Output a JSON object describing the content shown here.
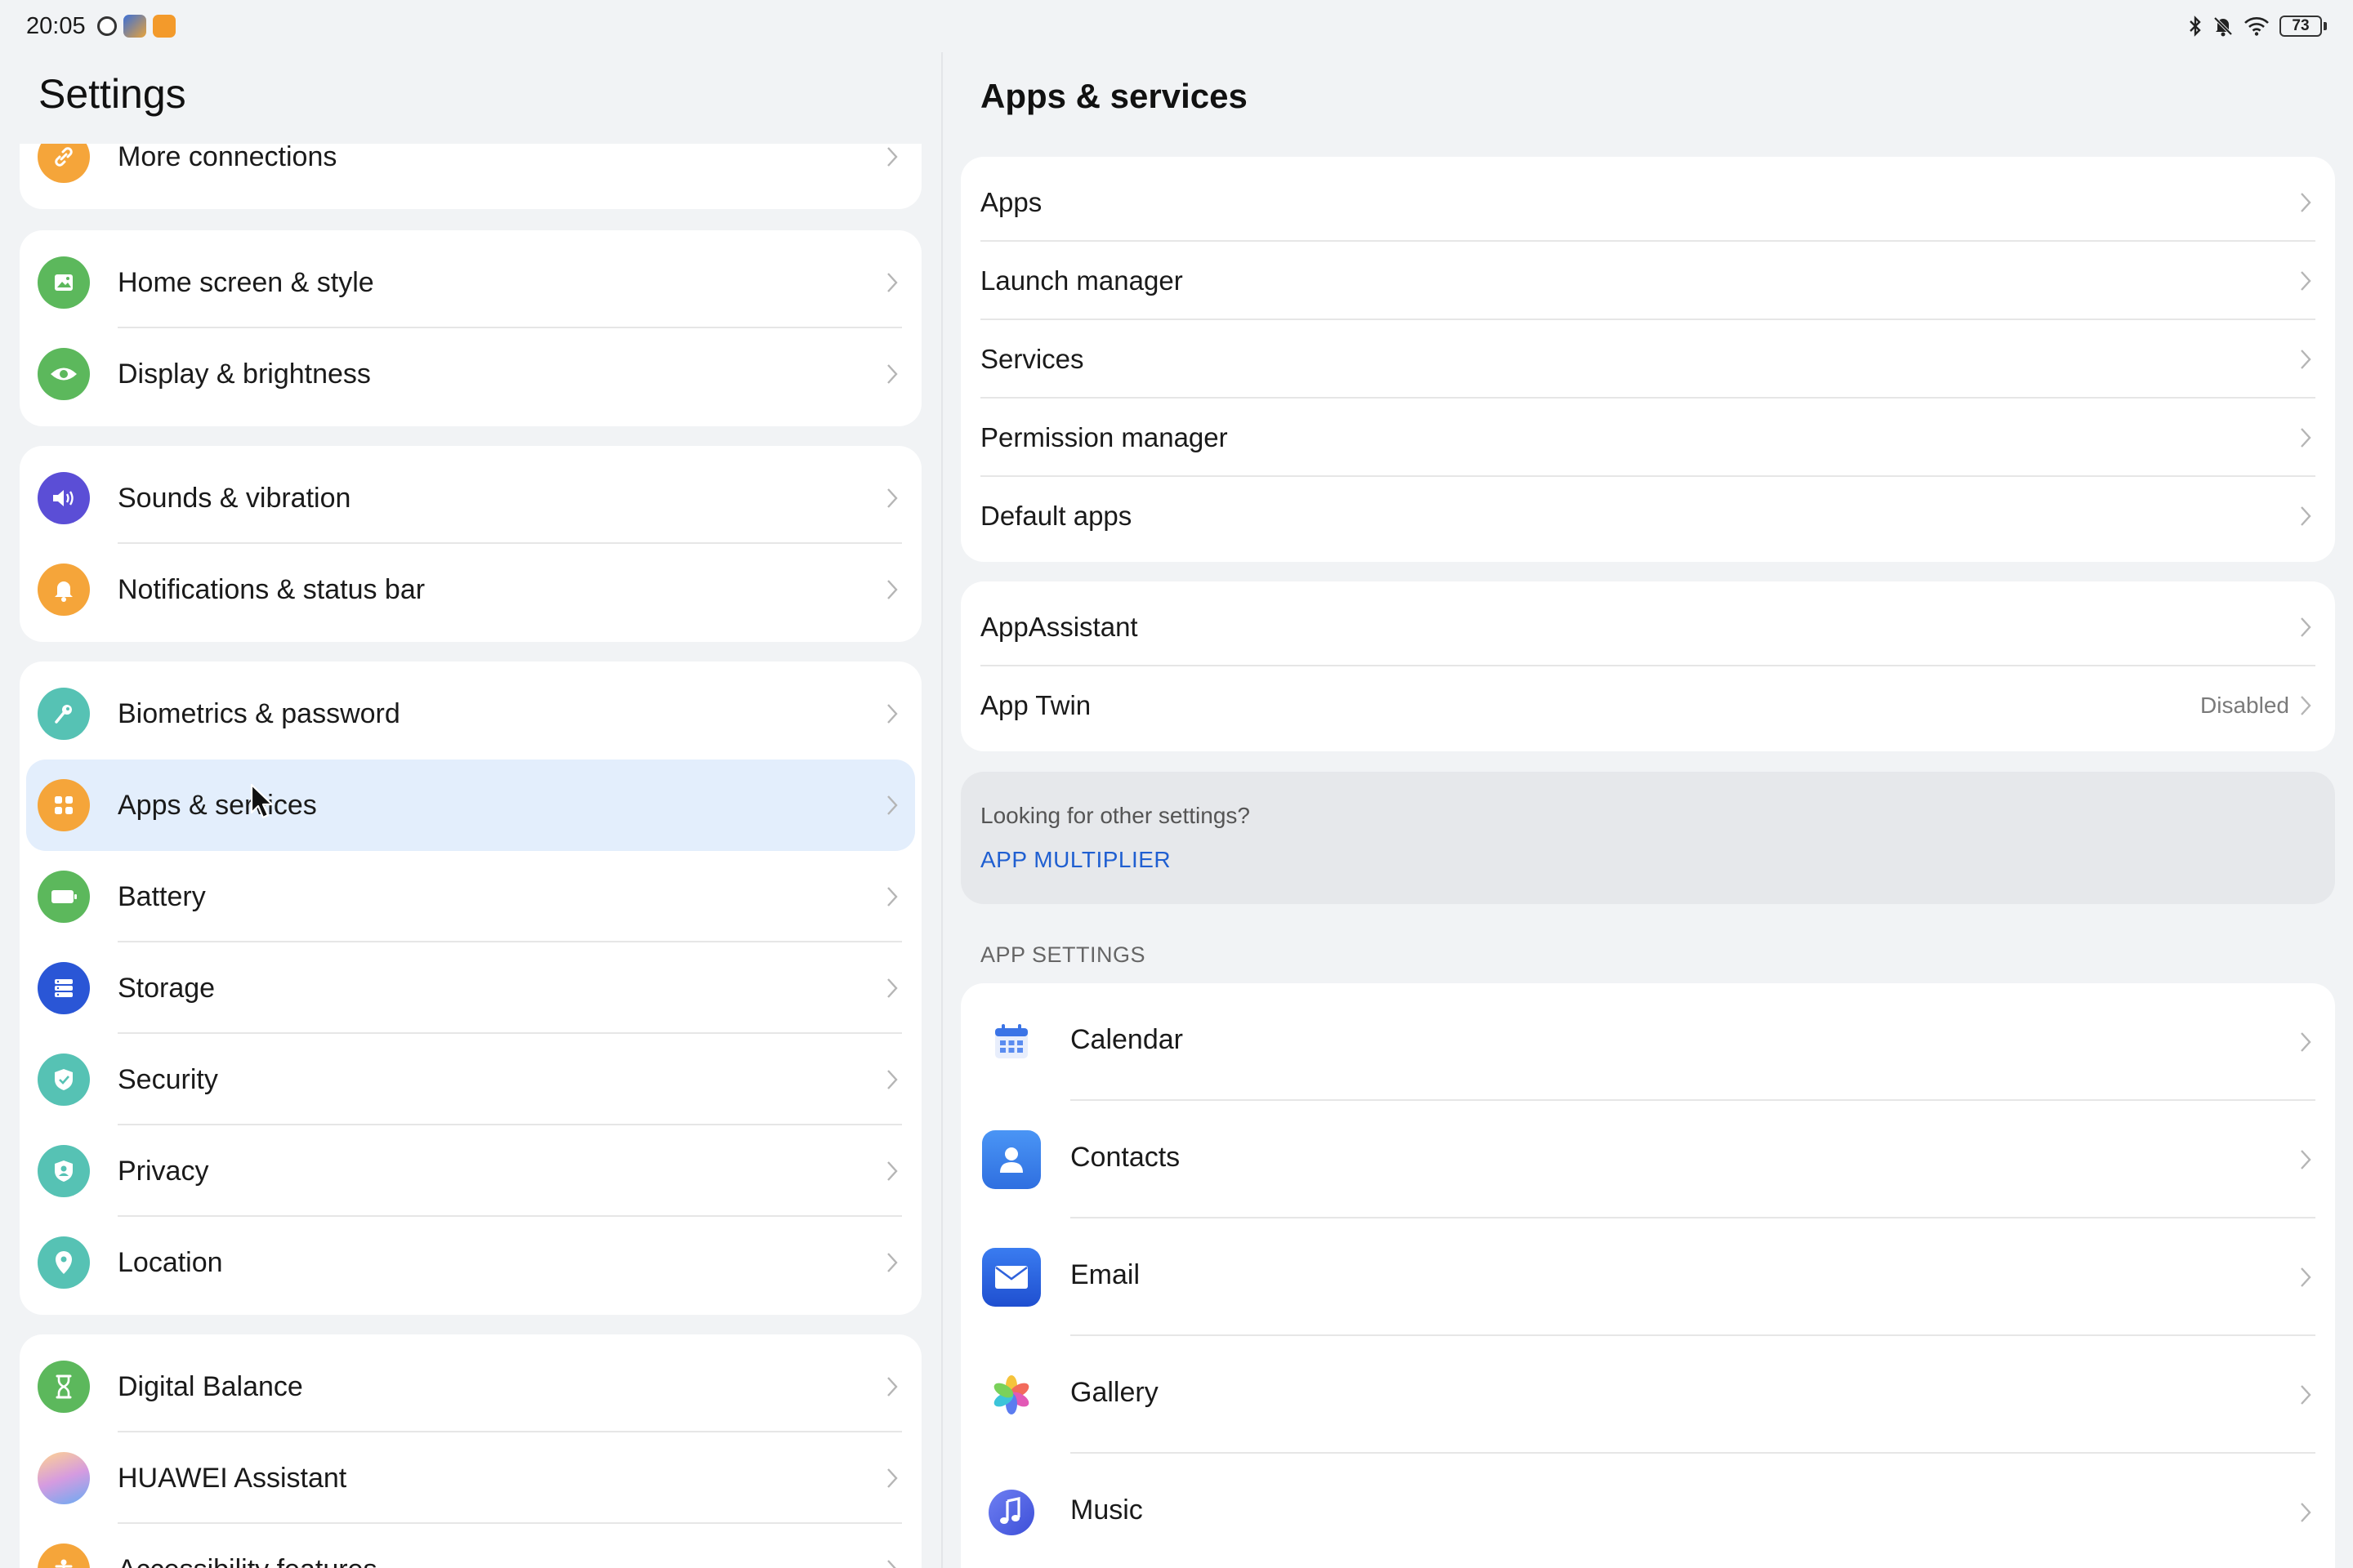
{
  "status_bar": {
    "time": "20:05",
    "battery_level": "73",
    "icons": [
      "app-notification-icon",
      "photo-app-icon",
      "orange-app-icon",
      "bluetooth-icon",
      "muted-bell-icon",
      "wifi-icon",
      "battery-icon"
    ]
  },
  "left": {
    "title": "Settings",
    "items": [
      {
        "label": "More connections",
        "icon": "link-icon",
        "color": "#f5a53a"
      },
      {
        "label": "Home screen & style",
        "icon": "image-icon",
        "color": "#5cb85c"
      },
      {
        "label": "Display & brightness",
        "icon": "eye-icon",
        "color": "#5cb85c"
      },
      {
        "label": "Sounds & vibration",
        "icon": "speaker-icon",
        "color": "#5b4ed6"
      },
      {
        "label": "Notifications & status bar",
        "icon": "bell-icon",
        "color": "#f5a53a"
      },
      {
        "label": "Biometrics & password",
        "icon": "key-icon",
        "color": "#56c2b4"
      },
      {
        "label": "Apps & services",
        "icon": "apps-grid-icon",
        "color": "#f5a53a"
      },
      {
        "label": "Battery",
        "icon": "battery-icon",
        "color": "#5cb85c"
      },
      {
        "label": "Storage",
        "icon": "storage-icon",
        "color": "#2a56d6"
      },
      {
        "label": "Security",
        "icon": "shield-check-icon",
        "color": "#56c2b4"
      },
      {
        "label": "Privacy",
        "icon": "privacy-shield-icon",
        "color": "#56c2b4"
      },
      {
        "label": "Location",
        "icon": "location-pin-icon",
        "color": "#56c2b4"
      },
      {
        "label": "Digital Balance",
        "icon": "hourglass-icon",
        "color": "#5cb85c"
      },
      {
        "label": "HUAWEI Assistant",
        "icon": "assistant-orb-icon",
        "color": "#c08ee8"
      },
      {
        "label": "Accessibility features",
        "icon": "accessibility-icon",
        "color": "#f5a53a"
      }
    ]
  },
  "right": {
    "title": "Apps & services",
    "group1": [
      {
        "label": "Apps"
      },
      {
        "label": "Launch manager"
      },
      {
        "label": "Services"
      },
      {
        "label": "Permission manager"
      },
      {
        "label": "Default apps"
      }
    ],
    "group2": [
      {
        "label": "AppAssistant",
        "value": ""
      },
      {
        "label": "App Twin",
        "value": "Disabled"
      }
    ],
    "hint": {
      "text": "Looking for other settings?",
      "link": "APP MULTIPLIER"
    },
    "section_label": "APP SETTINGS",
    "apps": [
      {
        "label": "Calendar",
        "icon": "calendar-icon"
      },
      {
        "label": "Contacts",
        "icon": "contacts-icon"
      },
      {
        "label": "Email",
        "icon": "email-icon"
      },
      {
        "label": "Gallery",
        "icon": "gallery-icon"
      },
      {
        "label": "Music",
        "icon": "music-icon"
      }
    ]
  },
  "colors": {
    "background": "#f1f3f5",
    "card": "#ffffff",
    "active_row": "#e3eefc",
    "link": "#1f5fd1"
  }
}
